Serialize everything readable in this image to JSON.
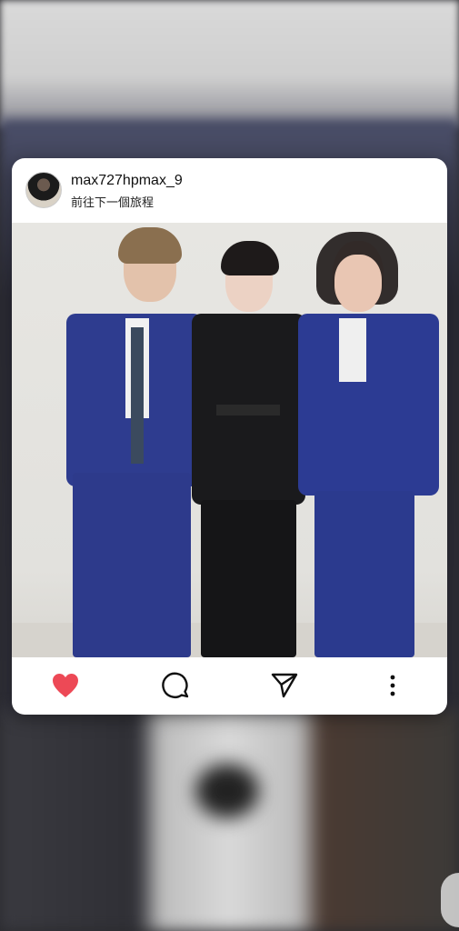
{
  "post": {
    "username": "max727hpmax_9",
    "location": "前往下一個旅程",
    "liked": true
  },
  "actions": {
    "like_icon": "heart-icon",
    "comment_icon": "comment-icon",
    "share_icon": "send-icon",
    "more_icon": "more-vertical-icon"
  },
  "colors": {
    "like": "#ed4956",
    "icon": "#111111",
    "card_bg": "#ffffff"
  }
}
